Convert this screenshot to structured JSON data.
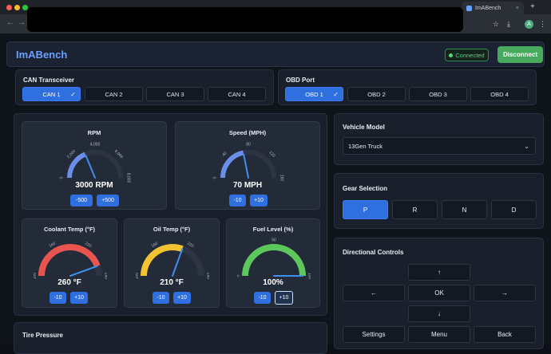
{
  "browser": {
    "tab_title": "ImABench",
    "tab_close": "×",
    "new_tab": "+"
  },
  "header": {
    "brand": "ImABench",
    "status": "Connected",
    "disconnect_label": "Disconnect"
  },
  "can": {
    "title": "CAN Transceiver",
    "options": [
      "CAN 1",
      "CAN 2",
      "CAN 3",
      "CAN 4"
    ],
    "selected": 0
  },
  "obd": {
    "title": "OBD Port",
    "options": [
      "OBD 1",
      "OBD 2",
      "OBD 3",
      "OBD 4"
    ],
    "selected": 0
  },
  "gauges": {
    "rpm": {
      "title": "RPM",
      "value_text": "3000 RPM",
      "value": 3000,
      "min": 0,
      "max": 8000,
      "ticks": [
        "0",
        "2,000",
        "4,000",
        "6,000",
        "8,000"
      ],
      "buttons": [
        "-500",
        "+500"
      ],
      "color": "#6b8fe8"
    },
    "speed": {
      "title": "Speed (MPH)",
      "value_text": "70 MPH",
      "value": 70,
      "min": 0,
      "max": 160,
      "ticks": [
        "0",
        "40",
        "80",
        "120",
        "160"
      ],
      "buttons": [
        "-10",
        "+10"
      ],
      "color": "#6b8fe8"
    },
    "coolant": {
      "title": "Coolant Temp (°F)",
      "value_text": "260 °F",
      "value": 260,
      "min": 100,
      "max": 280,
      "ticks": [
        "100",
        "160",
        "220",
        "280"
      ],
      "buttons": [
        "-10",
        "+10"
      ],
      "color": "#e8554f"
    },
    "oil": {
      "title": "Oil Temp (°F)",
      "value_text": "210 °F",
      "value": 210,
      "min": 100,
      "max": 280,
      "ticks": [
        "100",
        "160",
        "220",
        "280"
      ],
      "buttons": [
        "-10",
        "+10"
      ],
      "color": "#f2c233"
    },
    "fuel": {
      "title": "Fuel Level (%)",
      "value_text": "100%",
      "value": 100,
      "min": 0,
      "max": 100,
      "ticks": [
        "0",
        "50",
        "100"
      ],
      "buttons": [
        "-10",
        "+10"
      ],
      "color": "#5cc85c"
    }
  },
  "vehicle": {
    "title": "Vehicle Model",
    "selected": "13Gen Truck"
  },
  "gear": {
    "title": "Gear Selection",
    "options": [
      "P",
      "R",
      "N",
      "D"
    ],
    "selected": 0
  },
  "directional": {
    "title": "Directional Controls",
    "up": "↑",
    "left": "←",
    "ok": "OK",
    "right": "→",
    "down": "↓",
    "settings": "Settings",
    "menu": "Menu",
    "back": "Back"
  },
  "tire": {
    "title": "Tire Pressure"
  }
}
